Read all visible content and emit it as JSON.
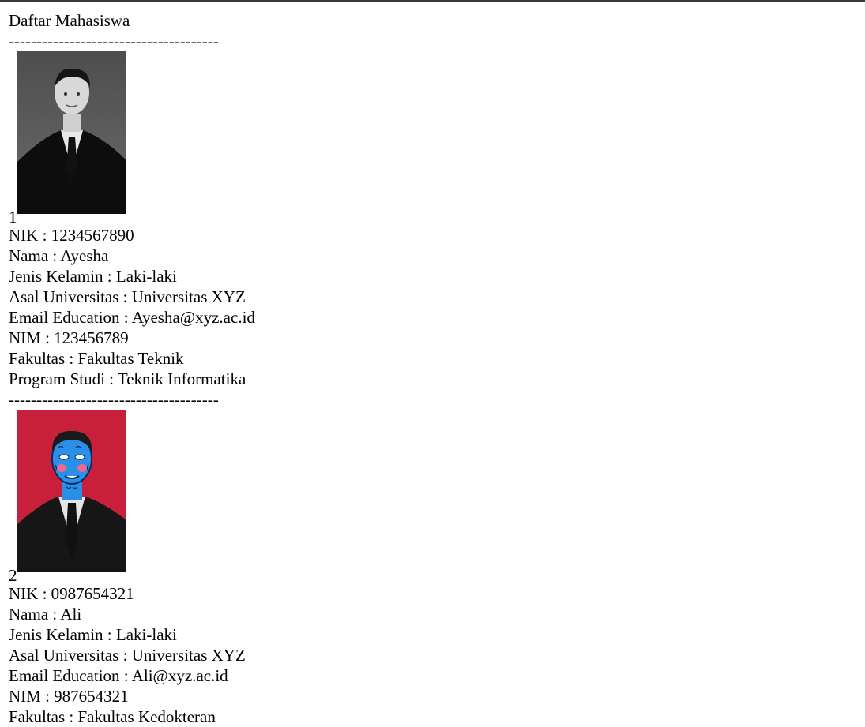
{
  "page": {
    "title": "Daftar Mahasiswa",
    "separator": "--------------------------------------"
  },
  "students": [
    {
      "index": "1",
      "photo_icon": "student-photo-grayscale",
      "nik": "NIK : 1234567890",
      "nama": "Nama : Ayesha",
      "jenis_kelamin": "Jenis Kelamin : Laki-laki",
      "asal_universitas": "Asal Universitas : Universitas XYZ",
      "email": "Email Education : Ayesha@xyz.ac.id",
      "nim": "NIM : 123456789",
      "fakultas": "Fakultas : Fakultas Teknik",
      "program_studi": "Program Studi : Teknik Informatika"
    },
    {
      "index": "2",
      "photo_icon": "student-photo-illustrated-red",
      "nik": "NIK : 0987654321",
      "nama": "Nama : Ali",
      "jenis_kelamin": "Jenis Kelamin : Laki-laki",
      "asal_universitas": "Asal Universitas : Universitas XYZ",
      "email": "Email Education : Ali@xyz.ac.id",
      "nim": "NIM : 987654321",
      "fakultas": "Fakultas : Fakultas Kedokteran"
    }
  ],
  "colors": {
    "photo1_bg": "#555555",
    "photo2_bg": "#c8203a",
    "face2": "#2a8fe8"
  }
}
